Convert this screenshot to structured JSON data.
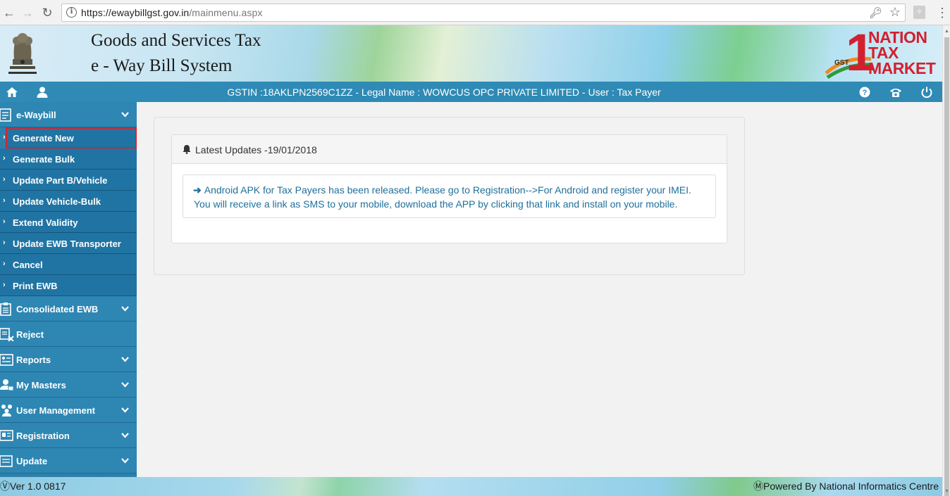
{
  "browser": {
    "url_host": "https://ewaybillgst.gov.in",
    "url_path": "/mainmenu.aspx"
  },
  "banner": {
    "title": "Goods and Services Tax",
    "subtitle": "e - Way Bill System",
    "logo_number": "1",
    "logo_lines": [
      "NATION",
      "TAX",
      "MARKET"
    ],
    "logo_gst": "GST"
  },
  "infobar": {
    "text": "GSTIN :18AKLPN2569C1ZZ - Legal Name : WOWCUS OPC PRIVATE LIMITED - User : Tax Payer"
  },
  "sidebar": {
    "ewaybill_label": "e-Waybill",
    "ewaybill_items": [
      "Generate New",
      "Generate Bulk",
      "Update Part B/Vehicle",
      "Update Vehicle-Bulk",
      "Extend Validity",
      "Update EWB Transporter",
      "Cancel",
      "Print EWB"
    ],
    "menus": [
      {
        "label": "Consolidated EWB",
        "icon": "clipboard-icon",
        "has_chevron": true
      },
      {
        "label": "Reject",
        "icon": "reject-document-icon",
        "has_chevron": false
      },
      {
        "label": "Reports",
        "icon": "reports-icon",
        "has_chevron": true
      },
      {
        "label": "My Masters",
        "icon": "masters-icon",
        "has_chevron": true
      },
      {
        "label": "User Management",
        "icon": "users-icon",
        "has_chevron": true
      },
      {
        "label": "Registration",
        "icon": "registration-icon",
        "has_chevron": true
      },
      {
        "label": "Update",
        "icon": "update-icon",
        "has_chevron": true
      }
    ],
    "selected_item": "Generate New"
  },
  "updates": {
    "title": "Latest Updates -19/01/2018",
    "line1": "Android APK for Tax Payers has been released. Please go to Registration-->For Android and register your IMEI.",
    "line2": "You will receive a link as SMS to your mobile, download the APP by clicking that link and install on your mobile."
  },
  "footer": {
    "version": "Ver 1.0 0817",
    "powered_by": "Powered By National Informatics Centre"
  },
  "colors": {
    "infobar": "#2f8ab5",
    "sidebar": "#2f7fab",
    "sub_item": "#2074a3",
    "selected_outline": "#d9232d",
    "update_text": "#1f6f9a",
    "logo_red": "#d3202f"
  }
}
